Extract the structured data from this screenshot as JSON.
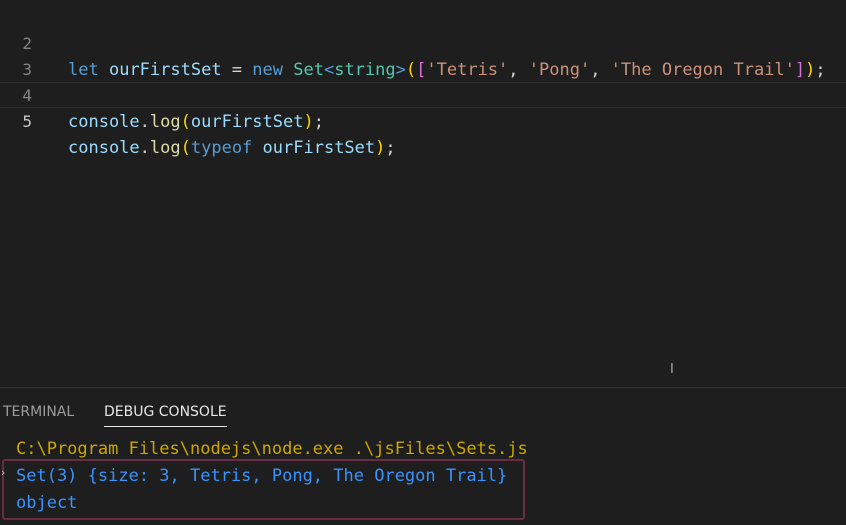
{
  "editor": {
    "lines": [
      {
        "number": "2",
        "tokens": [
          {
            "t": "let",
            "c": "kw"
          },
          {
            "t": " ",
            "c": "op"
          },
          {
            "t": "ourFirstSet",
            "c": "var"
          },
          {
            "t": " = ",
            "c": "op"
          },
          {
            "t": "new",
            "c": "kw"
          },
          {
            "t": " ",
            "c": "op"
          },
          {
            "t": "Set",
            "c": "type"
          },
          {
            "t": "<",
            "c": "kw"
          },
          {
            "t": "string",
            "c": "type"
          },
          {
            "t": ">",
            "c": "kw"
          },
          {
            "t": "(",
            "c": "b1"
          },
          {
            "t": "[",
            "c": "b2"
          },
          {
            "t": "'Tetris'",
            "c": "str"
          },
          {
            "t": ", ",
            "c": "op"
          },
          {
            "t": "'Pong'",
            "c": "str"
          },
          {
            "t": ", ",
            "c": "op"
          },
          {
            "t": "'The Oregon Trail'",
            "c": "str"
          },
          {
            "t": "]",
            "c": "b2"
          },
          {
            "t": ")",
            "c": "b1"
          },
          {
            "t": ";",
            "c": "op"
          }
        ]
      },
      {
        "number": "3",
        "tokens": []
      },
      {
        "number": "4",
        "tokens": [
          {
            "t": "console",
            "c": "var"
          },
          {
            "t": ".",
            "c": "op"
          },
          {
            "t": "log",
            "c": "fn"
          },
          {
            "t": "(",
            "c": "b1"
          },
          {
            "t": "ourFirstSet",
            "c": "var"
          },
          {
            "t": ")",
            "c": "b1"
          },
          {
            "t": ";",
            "c": "op"
          }
        ]
      },
      {
        "number": "5",
        "current": true,
        "tokens": [
          {
            "t": "console",
            "c": "var"
          },
          {
            "t": ".",
            "c": "op"
          },
          {
            "t": "log",
            "c": "fn"
          },
          {
            "t": "(",
            "c": "b1"
          },
          {
            "t": "typeof",
            "c": "kw"
          },
          {
            "t": " ",
            "c": "op"
          },
          {
            "t": "ourFirstSet",
            "c": "var"
          },
          {
            "t": ")",
            "c": "b1"
          },
          {
            "t": ";",
            "c": "op"
          }
        ]
      }
    ]
  },
  "panel": {
    "tabs": {
      "terminal": "TERMINAL",
      "debug_console": "DEBUG CONSOLE"
    },
    "output": {
      "command": "C:\\Program Files\\nodejs\\node.exe .\\jsFiles\\Sets.js",
      "set_line": "Set(3) {size: 3, Tetris, Pong, The Oregon Trail}",
      "type_line": "object"
    },
    "expand_glyph": "›"
  },
  "colors": {
    "background": "#1e1e1e",
    "keyword": "#569cd6",
    "variable": "#9cdcfe",
    "function": "#dcdcaa",
    "type": "#4ec9b0",
    "string": "#ce9178",
    "console_path": "#cca700",
    "console_output": "#3794ff",
    "highlight_border": "#6b2b45"
  },
  "icons": {
    "mouse_cursor": "text-ibeam-icon"
  }
}
